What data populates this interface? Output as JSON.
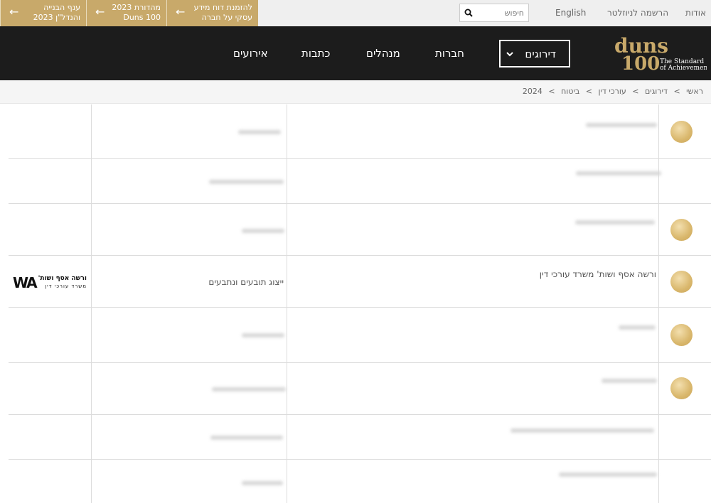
{
  "topbar": {
    "promos": [
      {
        "line1": "להזמנת דוח מידע",
        "line2": "עסקי על חברה"
      },
      {
        "line1": "מהדורת 2023",
        "line2": "Duns 100"
      },
      {
        "line1": "ענף הבנייה",
        "line2": "והנדל\"ן 2023"
      }
    ],
    "search_placeholder": "חיפוש",
    "links": {
      "english": "English",
      "newsletter": "הרשמה לניוזלטר",
      "about": "אודות"
    }
  },
  "nav": {
    "logo_word": "duns",
    "logo_num": "100",
    "logo_tag1": "The Standard",
    "logo_tag2": "of Achievement",
    "dropdown_label": "דירוגים",
    "items": {
      "companies": "חברות",
      "managers": "מנהלים",
      "articles": "כתבות",
      "events": "אירועים"
    }
  },
  "breadcrumb": {
    "home": "ראשי",
    "rankings": "דירוגים",
    "lawyers": "עורכי דין",
    "insurance": "ביטוח",
    "year": "2024",
    "sep": ">"
  },
  "table": {
    "visible_row": {
      "firm": "ורשה אסף ושות' משרד עורכי דין",
      "field": "ייצוג תובעים ונתבעים",
      "logo_mark": "WA",
      "logo_name": "ורשה אסף ושות'",
      "logo_sub": "משרד עורכי דין"
    }
  },
  "colors": {
    "gold": "#c8a96a",
    "dark": "#1c1c1c"
  }
}
